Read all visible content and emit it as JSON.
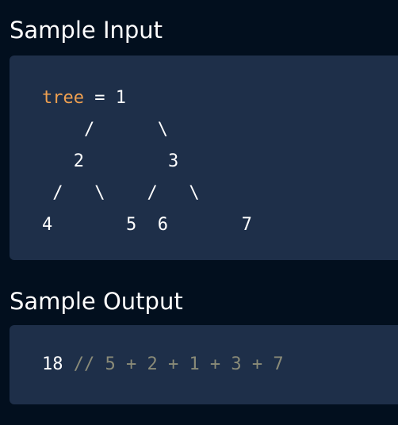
{
  "sections": {
    "input": {
      "title": "Sample Input",
      "var_name": "tree",
      "line0_rest": " = 1",
      "lines": [
        "    /      \\",
        "   2        3",
        " /   \\    /   \\",
        "4       5  6       7"
      ]
    },
    "output": {
      "title": "Sample Output",
      "value": "18",
      "comment": " // 5 + 2 + 1 + 3 + 7"
    }
  },
  "colors": {
    "background": "#020f1e",
    "code_block": "#1e2f49",
    "variable": "#f0a050",
    "comment": "#8a8b78",
    "text": "#ffffff"
  }
}
